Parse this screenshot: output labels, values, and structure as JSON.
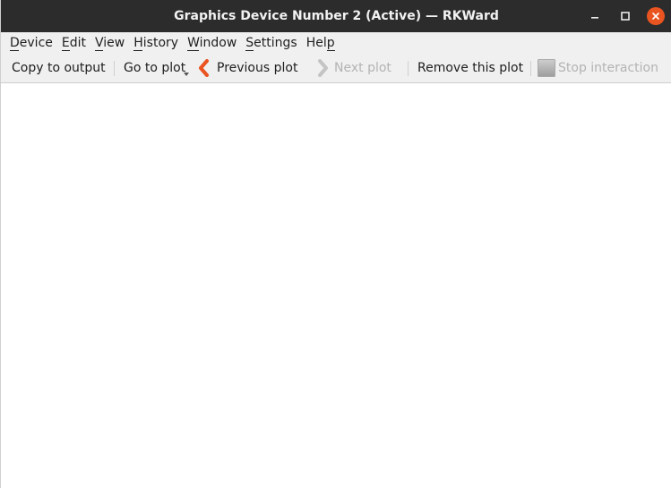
{
  "window": {
    "title": "Graphics Device Number 2 (Active) — RKWard"
  },
  "titlebar_buttons": {
    "minimize_icon": "minimize-icon",
    "maximize_icon": "maximize-icon",
    "close_icon": "close-icon",
    "close_color": "#e95420"
  },
  "menubar": {
    "items": [
      {
        "label": "Device"
      },
      {
        "label": "Edit"
      },
      {
        "label": "View"
      },
      {
        "label": "History"
      },
      {
        "label": "Window"
      },
      {
        "label": "Settings"
      },
      {
        "label": "Help"
      }
    ]
  },
  "toolbar": {
    "copy_to_output": "Copy to output",
    "go_to_plot": "Go to plot",
    "previous_plot": "Previous plot",
    "next_plot": "Next plot",
    "remove_this_plot": "Remove this plot",
    "stop_interaction": "Stop interaction",
    "next_plot_enabled": false,
    "stop_interaction_enabled": false,
    "accent_color": "#e95420"
  }
}
